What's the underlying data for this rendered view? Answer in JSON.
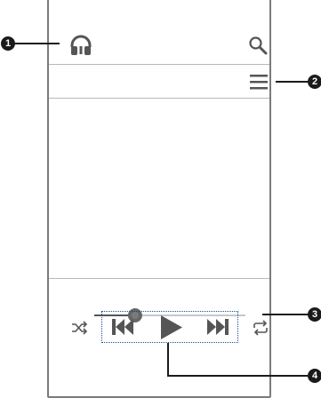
{
  "callouts": {
    "c1": "1",
    "c2": "2",
    "c3": "3",
    "c4": "4"
  },
  "colors": {
    "frame": "#7a7a7a",
    "icon": "#555555",
    "callout": "#1a1a1a",
    "dotted_box": "#1a4f99",
    "slider_track": "#c8c8c8",
    "slider_fill": "#555555"
  },
  "icons": {
    "top_left": "headphones-icon",
    "top_right": "search-icon",
    "menu": "menu-icon",
    "shuffle": "shuffle-icon",
    "previous": "previous-icon",
    "play": "play-icon",
    "next": "next-icon",
    "repeat": "repeat-icon"
  },
  "playback": {
    "progress": 0.27
  }
}
